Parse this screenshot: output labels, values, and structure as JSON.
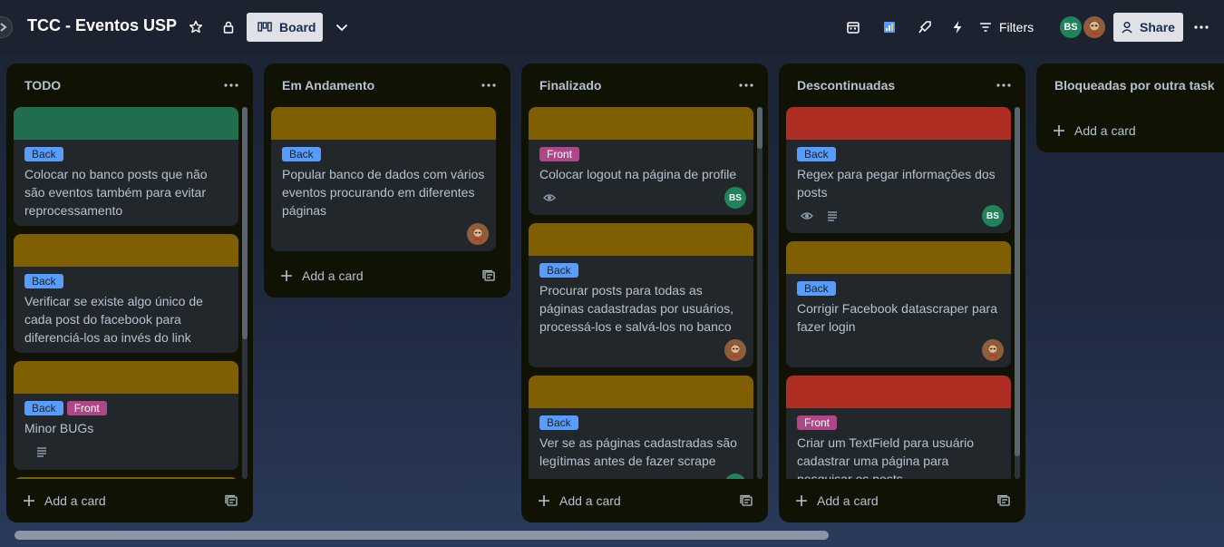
{
  "board": {
    "title": "TCC - Eventos USP",
    "view_label": "Board",
    "filters_label": "Filters",
    "share_label": "Share",
    "members": [
      {
        "initials": "BS",
        "color": "#1f845a"
      },
      {
        "initials": "",
        "color": "#8f5d3a"
      }
    ]
  },
  "colors": {
    "green_cover": "#216e4e",
    "yellow_cover": "#7f5f01",
    "red_cover": "#ae2e24",
    "back_label": "#579dff",
    "front_label": "#ae4787"
  },
  "labels": {
    "back": "Back",
    "front": "Front"
  },
  "lists": [
    {
      "title": "TODO",
      "add_label": "Add a card",
      "cards": [
        {
          "title_lines": [
            "Colocar no banco posts que não",
            "são eventos também para evitar",
            "reprocessamento"
          ]
        },
        {
          "title_lines": [
            "Verificar se existe algo único de",
            "cada post do facebook para",
            "diferenciá-los ao invés do link"
          ]
        },
        {
          "title_lines": [
            "Minor BUGs"
          ]
        }
      ]
    },
    {
      "title": "Em Andamento",
      "add_label": "Add a card",
      "cards": [
        {
          "title_lines": [
            "Popular banco de dados com vários",
            "eventos procurando em diferentes",
            "páginas"
          ]
        }
      ]
    },
    {
      "title": "Finalizado",
      "add_label": "Add a card",
      "cards": [
        {
          "title_lines": [
            "Colocar logout na página de profile"
          ],
          "avatar": "BS"
        },
        {
          "title_lines": [
            "Procurar posts para todas as",
            "páginas cadastradas por usuários,",
            "processá-los e salvá-los no banco"
          ]
        },
        {
          "title_lines": [
            "Ver se as páginas cadastradas são",
            "legítimas antes de fazer scrape"
          ]
        }
      ]
    },
    {
      "title": "Descontinuadas",
      "add_label": "Add a card",
      "cards": [
        {
          "title_lines": [
            "Regex para pegar informações dos",
            "posts"
          ],
          "avatar": "BS"
        },
        {
          "title_lines": [
            "Corrigir Facebook datascraper para",
            "fazer login"
          ]
        },
        {
          "title_lines": [
            "Criar um TextField para usuário",
            "cadastrar uma página para",
            "pesquisar os posts"
          ]
        }
      ]
    },
    {
      "title": "Bloqueadas por outra task",
      "add_label": "Add a card",
      "cards": []
    }
  ]
}
